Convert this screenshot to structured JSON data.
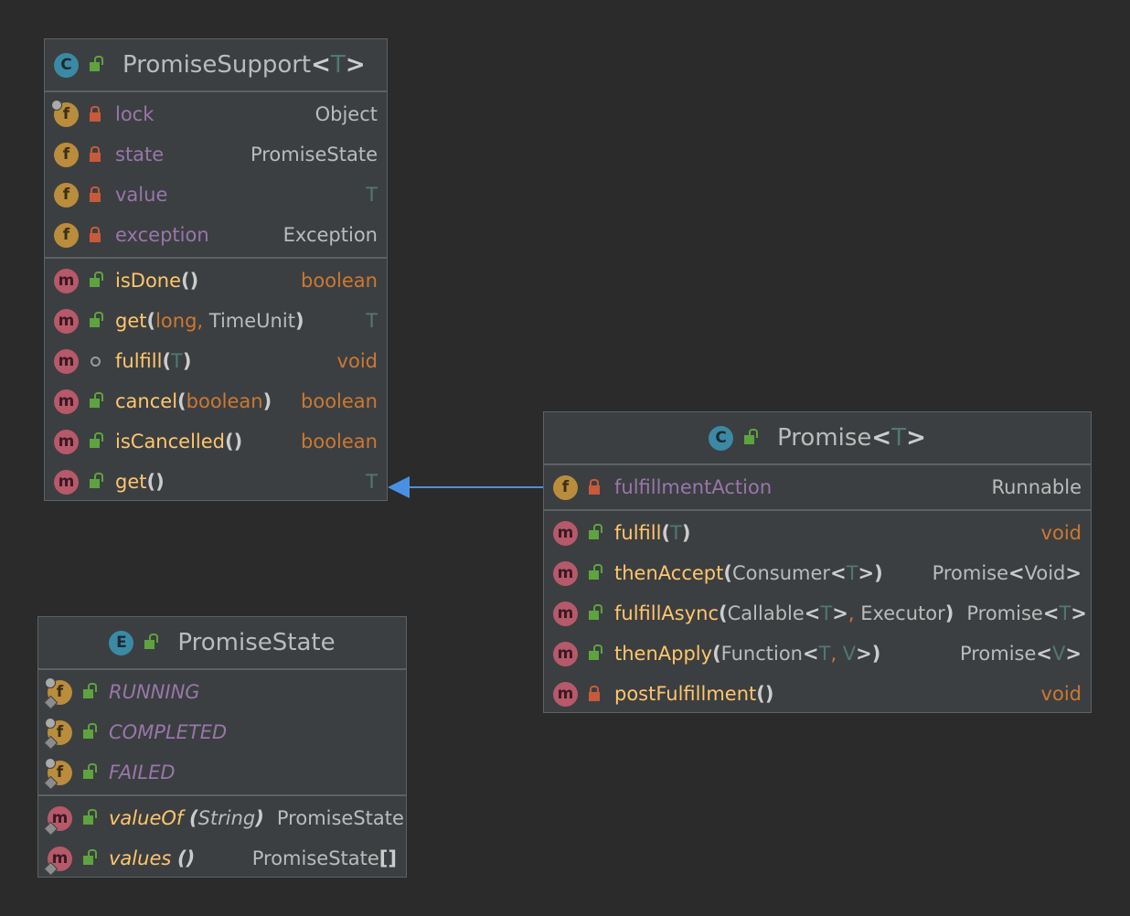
{
  "diagram": {
    "promise_support": {
      "icon": "class-icon",
      "name": "PromiseSupport",
      "lt": "<",
      "type_param": "T",
      "gt": ">",
      "fields": [
        {
          "name": "lock",
          "type": "Object",
          "visibility": "private"
        },
        {
          "name": "state",
          "type": "PromiseState",
          "visibility": "private"
        },
        {
          "name": "value",
          "type": "T",
          "visibility": "private"
        },
        {
          "name": "exception",
          "type": "Exception",
          "visibility": "private"
        }
      ],
      "methods": [
        {
          "name": "isDone",
          "open": "(",
          "close": ")",
          "type": "boolean",
          "visibility": "public"
        },
        {
          "name": "get",
          "open": "(",
          "p1": "long",
          "comma": ",",
          "p2": " TimeUnit",
          "close": ")",
          "type": "T",
          "visibility": "public"
        },
        {
          "name": "fulfill",
          "open": "(",
          "p1": "T",
          "close": ")",
          "type": "void",
          "visibility": "package"
        },
        {
          "name": "cancel",
          "open": "(",
          "p1": "boolean",
          "close": ")",
          "type": "boolean",
          "visibility": "public"
        },
        {
          "name": "isCancelled",
          "open": "(",
          "close": ")",
          "type": "boolean",
          "visibility": "public"
        },
        {
          "name": "get",
          "open": "(",
          "close": ")",
          "type": "T",
          "visibility": "public"
        }
      ]
    },
    "promise": {
      "icon": "class-icon",
      "name": "Promise",
      "lt": "<",
      "type_param": "T",
      "gt": ">",
      "fields": [
        {
          "name": "fulfillmentAction",
          "type": "Runnable",
          "visibility": "private"
        }
      ],
      "methods": [
        {
          "name": "fulfill",
          "open": "(",
          "p1": "T",
          "close": ")",
          "type": "void",
          "visibility": "public"
        },
        {
          "name": "thenAccept",
          "open": "(",
          "p1": "Consumer",
          "lt": "<",
          "tp": "T",
          "gt": ">",
          "close": ")",
          "type_main": "Promise",
          "type_lt": "<",
          "type_arg": "Void",
          "type_gt": ">",
          "visibility": "public"
        },
        {
          "name": "fulfillAsync",
          "open": "(",
          "p1": "Callable",
          "lt": "<",
          "tp": "T",
          "gt": ">",
          "comma": ",",
          "p2": " Executor",
          "close": ")",
          "type_main": "Promise",
          "type_lt": "<",
          "type_arg": "T",
          "type_gt": ">",
          "visibility": "public"
        },
        {
          "name": "thenApply",
          "open": "(",
          "p1": "Function",
          "lt": "<",
          "tp": "T",
          "comma": ",",
          "tp2": " V",
          "gt": ">",
          "close": ")",
          "type_main": "Promise",
          "type_lt": "<",
          "type_arg": "V",
          "type_gt": ">",
          "visibility": "public"
        },
        {
          "name": "postFulfillment",
          "open": "(",
          "close": ")",
          "type": "void",
          "visibility": "private"
        }
      ]
    },
    "promise_state": {
      "icon": "enum-icon",
      "name": "PromiseState",
      "constants": [
        "RUNNING",
        "COMPLETED",
        "FAILED"
      ],
      "methods": [
        {
          "name": "valueOf",
          "open": "(",
          "p1": "String",
          "close": ")",
          "type": "PromiseState",
          "visibility": "public"
        },
        {
          "name": "values",
          "open": "(",
          "close": ")",
          "type_main": "PromiseState",
          "type_arr": "[]",
          "visibility": "public"
        }
      ]
    },
    "badges": {
      "class": "C",
      "enum": "E",
      "field": "f",
      "method": "m"
    },
    "colors": {
      "background": "#2b2b2b",
      "box": "#3c3f41",
      "border": "#5c6164",
      "field": "#9876aa",
      "method": "#ffc66d",
      "keyword": "#cc7832",
      "type_param": "#507874",
      "arrow": "#4a90e2"
    },
    "relation": {
      "from": "promise",
      "to": "promise_support",
      "kind": "extends"
    }
  }
}
